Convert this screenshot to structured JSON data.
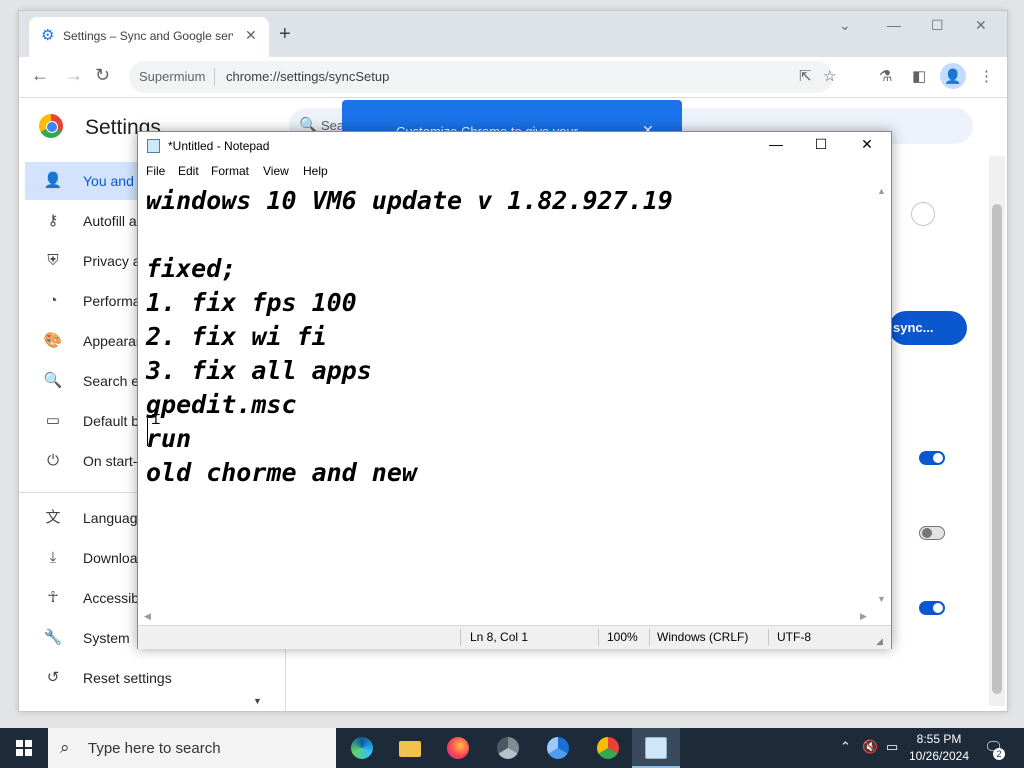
{
  "chrome": {
    "tab_title": "Settings – Sync and Google services",
    "site_chip": "Supermium",
    "url": "chrome://settings/syncSetup",
    "settings_title": "Settings",
    "search_placeholder": "Search settings",
    "promo_text": "Customize Chrome to give your",
    "sync_button": "sync...",
    "sidebar": [
      {
        "label": "You and Google",
        "icon": "person-icon"
      },
      {
        "label": "Autofill and passwords",
        "icon": "key-icon"
      },
      {
        "label": "Privacy and security",
        "icon": "shield-icon"
      },
      {
        "label": "Performance",
        "icon": "speedometer-icon"
      },
      {
        "label": "Appearance",
        "icon": "palette-icon"
      },
      {
        "label": "Search engine",
        "icon": "search-icon"
      },
      {
        "label": "Default browser",
        "icon": "browser-icon"
      },
      {
        "label": "On start-up",
        "icon": "power-icon"
      },
      {
        "label": "Languages",
        "icon": "translate-icon"
      },
      {
        "label": "Downloads",
        "icon": "download-icon"
      },
      {
        "label": "Accessibility",
        "icon": "accessibility-icon"
      },
      {
        "label": "System",
        "icon": "wrench-icon"
      },
      {
        "label": "Reset settings",
        "icon": "reset-icon"
      }
    ],
    "toggles": [
      true,
      false,
      true
    ]
  },
  "notepad": {
    "title": "*Untitled - Notepad",
    "menu": [
      "File",
      "Edit",
      "Format",
      "View",
      "Help"
    ],
    "lines": [
      "windows 10 VM6 update v 1.82.927.19",
      "",
      "fixed;",
      "1. fix fps 100",
      "2. fix wi fi",
      "3. fix all apps",
      "gpedit.msc",
      "run",
      "old chorme and new"
    ],
    "status": {
      "position": "Ln 8, Col 1",
      "zoom": "100%",
      "line_ending": "Windows (CRLF)",
      "encoding": "UTF-8"
    }
  },
  "taskbar": {
    "search_placeholder": "Type here to search",
    "apps": [
      "edge-icon",
      "file-explorer-icon",
      "firefox-icon",
      "chrome-beta-icon",
      "chromium-icon",
      "chrome-icon",
      "notepad-icon"
    ],
    "time": "8:55 PM",
    "date": "10/26/2024",
    "notifications": "2"
  }
}
